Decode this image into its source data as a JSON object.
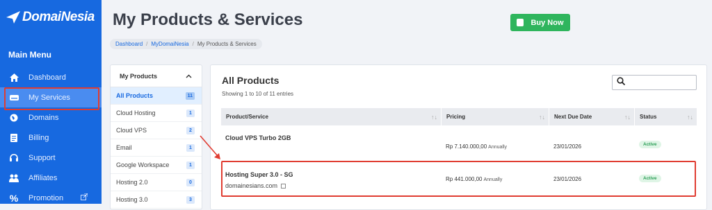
{
  "brand": {
    "name": "DomaiNesia"
  },
  "sidebar": {
    "menu_title": "Main Menu",
    "items": [
      {
        "label": "Dashboard",
        "icon": "home-icon"
      },
      {
        "label": "My Services",
        "icon": "server-icon",
        "active": true
      },
      {
        "label": "Domains",
        "icon": "globe-icon"
      },
      {
        "label": "Billing",
        "icon": "document-icon"
      },
      {
        "label": "Support",
        "icon": "headset-icon"
      },
      {
        "label": "Affiliates",
        "icon": "users-icon"
      },
      {
        "label": "Promotion",
        "icon": "percent-icon",
        "external": true
      }
    ]
  },
  "header": {
    "title": "My Products & Services",
    "buy_now": "Buy Now"
  },
  "breadcrumb": {
    "items": [
      "Dashboard",
      "MyDomaiNesia",
      "My Products & Services"
    ]
  },
  "categories": {
    "title": "My Products",
    "items": [
      {
        "label": "All Products",
        "count": "11",
        "active": true
      },
      {
        "label": "Cloud Hosting",
        "count": "1"
      },
      {
        "label": "Cloud VPS",
        "count": "2"
      },
      {
        "label": "Email",
        "count": "1"
      },
      {
        "label": "Google Workspace",
        "count": "1"
      },
      {
        "label": "Hosting 2.0",
        "count": "0"
      },
      {
        "label": "Hosting 3.0",
        "count": "3"
      }
    ]
  },
  "products": {
    "title": "All Products",
    "subtitle": "Showing 1 to 10 of 11 entries",
    "columns": [
      "Product/Service",
      "Pricing",
      "Next Due Date",
      "Status"
    ],
    "rows": [
      {
        "name": "Cloud VPS Turbo 2GB",
        "domain": "",
        "price": "Rp 7.140.000,00",
        "cycle": "Annually",
        "due": "23/01/2026",
        "status": "Active"
      },
      {
        "name": "Hosting Super 3.0 - SG",
        "domain": "domainesians.com",
        "price": "Rp 441.000,00",
        "cycle": "Annually",
        "due": "23/01/2026",
        "status": "Active"
      }
    ]
  },
  "colors": {
    "sidebar": "#1769e0",
    "accent_green": "#2fb55d",
    "highlight_red": "#e03c31"
  }
}
